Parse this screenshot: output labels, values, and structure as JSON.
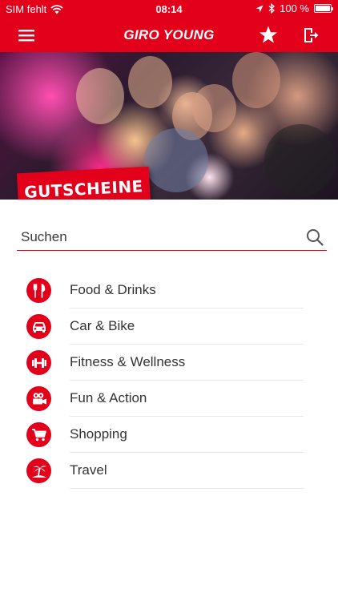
{
  "status": {
    "carrier": "SIM fehlt",
    "time": "08:14",
    "battery": "100 %",
    "battery_level": 1.0
  },
  "header": {
    "title": "GIRO YOUNG"
  },
  "hero": {
    "badge": "GUTSCHEINE"
  },
  "search": {
    "placeholder": "Suchen"
  },
  "categories": [
    {
      "label": "Food & Drinks",
      "icon": "cutlery-icon"
    },
    {
      "label": "Car & Bike",
      "icon": "car-icon"
    },
    {
      "label": "Fitness & Wellness",
      "icon": "dumbbell-icon"
    },
    {
      "label": "Fun & Action",
      "icon": "camera-icon"
    },
    {
      "label": "Shopping",
      "icon": "cart-icon"
    },
    {
      "label": "Travel",
      "icon": "palm-island-icon"
    }
  ],
  "colors": {
    "brand": "#e2001a",
    "text": "#333333",
    "separator": "#e6e6e6"
  }
}
